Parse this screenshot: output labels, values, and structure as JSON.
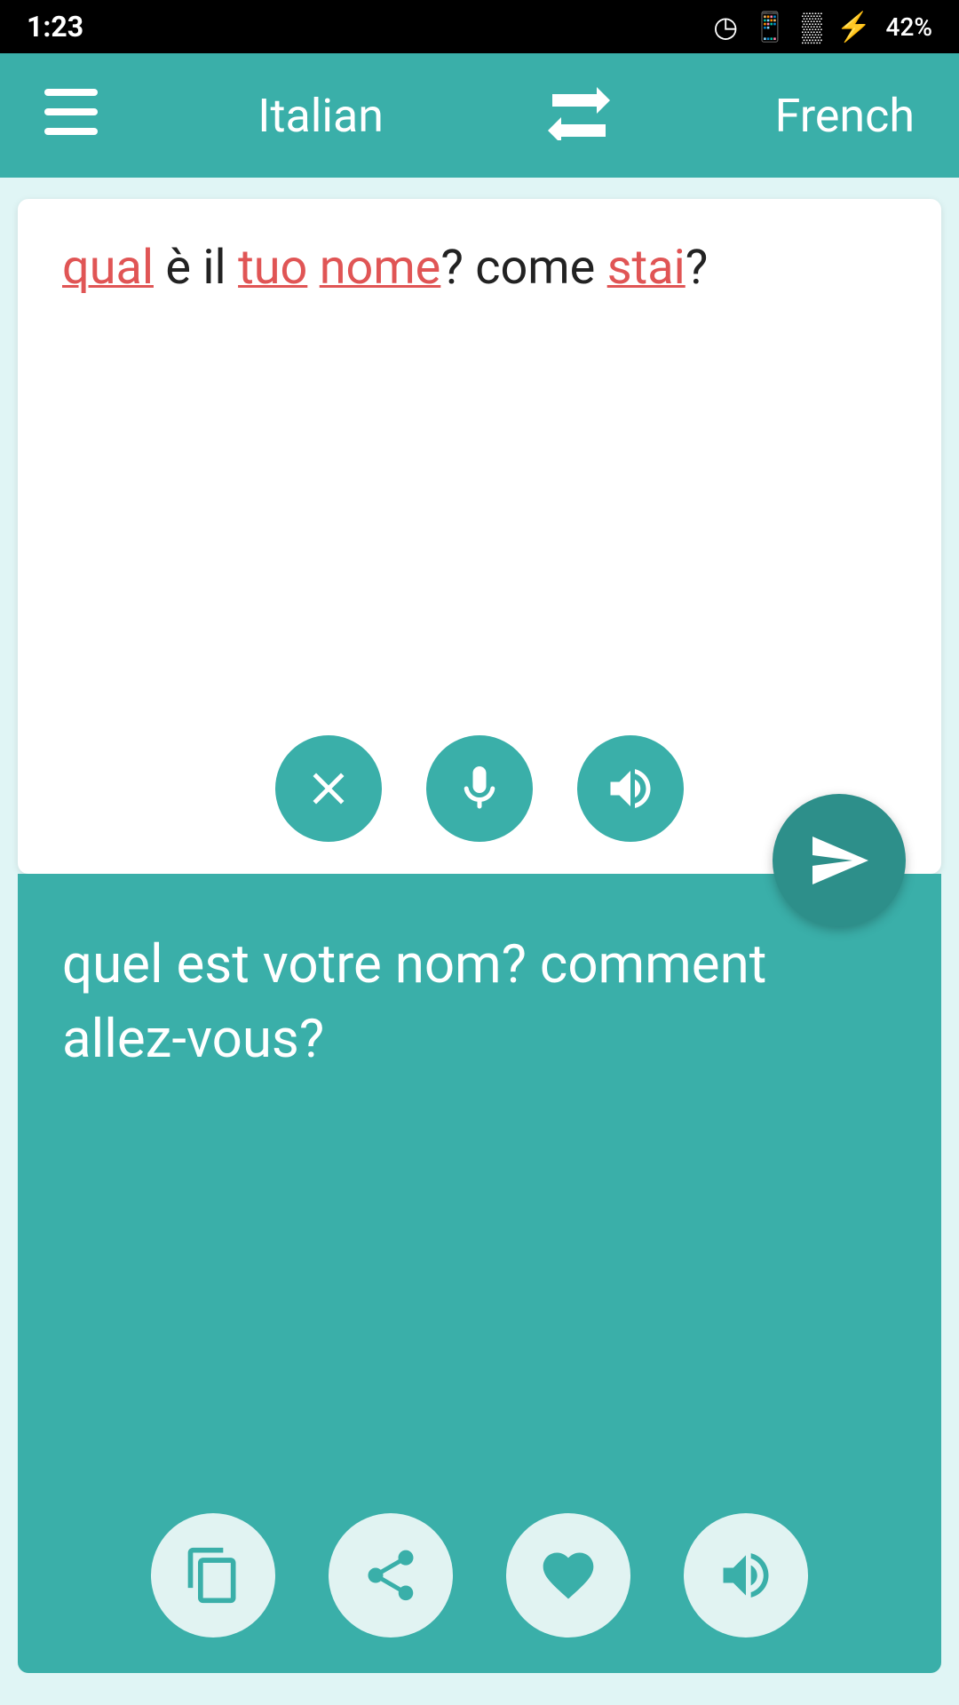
{
  "statusBar": {
    "time": "1:23",
    "battery": "42%"
  },
  "toolbar": {
    "sourceLang": "Italian",
    "targetLang": "French",
    "menuIcon": "☰",
    "swapIcon": "⇄"
  },
  "inputPanel": {
    "text": "qual è il tuo nome? come stai?",
    "words": [
      {
        "text": "qual",
        "underline": true
      },
      {
        "text": " è il ",
        "underline": false
      },
      {
        "text": "tuo",
        "underline": true
      },
      {
        "text": " ",
        "underline": false
      },
      {
        "text": "nome",
        "underline": true
      },
      {
        "text": "? come ",
        "underline": false
      },
      {
        "text": "stai",
        "underline": true
      },
      {
        "text": "?",
        "underline": false
      }
    ],
    "buttons": {
      "clear": "clear-button",
      "mic": "mic-button",
      "speak": "speak-button"
    }
  },
  "outputPanel": {
    "text": "quel est votre nom? comment allez-vous?",
    "buttons": {
      "copy": "copy-button",
      "share": "share-button",
      "favorite": "favorite-button",
      "speak": "speak-output-button"
    }
  }
}
